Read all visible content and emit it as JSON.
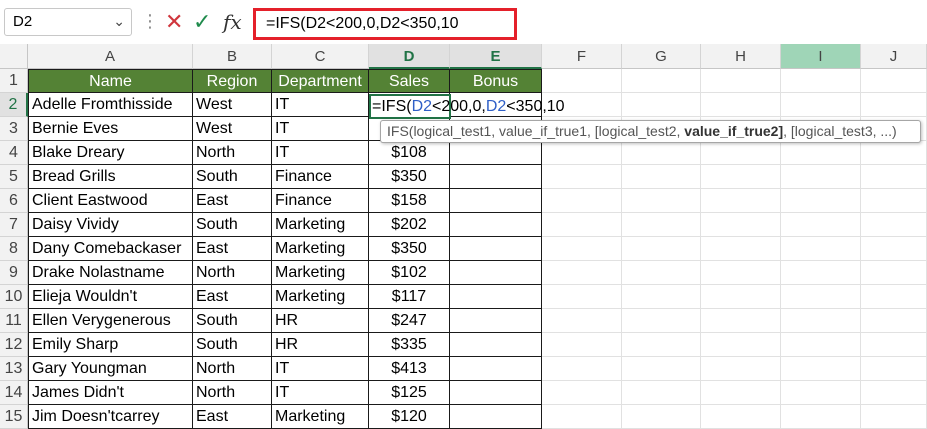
{
  "name_box": {
    "value": "D2"
  },
  "formula_bar": {
    "formula": "=IFS(D2<200,0,D2<350,10",
    "fx": "fx"
  },
  "columns": [
    "A",
    "B",
    "C",
    "D",
    "E",
    "F",
    "G",
    "H",
    "I",
    "J"
  ],
  "rows": [
    "1",
    "2",
    "3",
    "4",
    "5",
    "6",
    "7",
    "8",
    "9",
    "10",
    "11",
    "12",
    "13",
    "14",
    "15"
  ],
  "table_header": [
    "Name",
    "Region",
    "Department",
    "Sales",
    "Bonus"
  ],
  "table_rows": [
    [
      "Adelle Fromthisside",
      "West",
      "IT",
      "",
      ""
    ],
    [
      "Bernie Eves",
      "West",
      "IT",
      "",
      ""
    ],
    [
      "Blake Dreary",
      "North",
      "IT",
      "$108",
      ""
    ],
    [
      "Bread Grills",
      "South",
      "Finance",
      "$350",
      ""
    ],
    [
      "Client Eastwood",
      "East",
      "Finance",
      "$158",
      ""
    ],
    [
      "Daisy Vividy",
      "South",
      "Marketing",
      "$202",
      ""
    ],
    [
      "Dany Comebackaser",
      "East",
      "Marketing",
      "$350",
      ""
    ],
    [
      "Drake Nolastname",
      "North",
      "Marketing",
      "$102",
      ""
    ],
    [
      "Elieja Wouldn't",
      "East",
      "Marketing",
      "$117",
      ""
    ],
    [
      "Ellen Verygenerous",
      "South",
      "HR",
      "$247",
      ""
    ],
    [
      "Emily Sharp",
      "South",
      "HR",
      "$335",
      ""
    ],
    [
      "Gary Youngman",
      "North",
      "IT",
      "$413",
      ""
    ],
    [
      "James Didn't",
      "North",
      "IT",
      "$125",
      ""
    ],
    [
      "Jim Doesn'tcarrey",
      "East",
      "Marketing",
      "$120",
      ""
    ]
  ],
  "active_cell": {
    "p1": "=IFS(",
    "r1": "D2",
    "p2": "<200,0,",
    "r2": "D2",
    "p3": "<350,10"
  },
  "tooltip": {
    "t1": "IFS(logical_test1, value_if_true1, [logical_test2, ",
    "bold": "value_if_true2]",
    "t2": ", [logical_test3, ...)"
  }
}
